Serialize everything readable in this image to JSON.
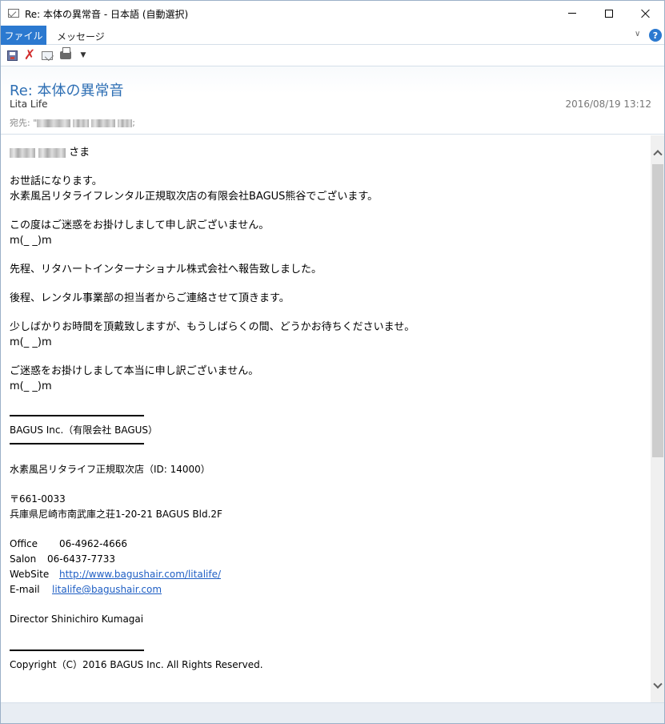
{
  "window": {
    "title": "Re: 本体の異常音 - 日本語 (自動選択)"
  },
  "ribbon": {
    "tabs": [
      "ファイル",
      "メッセージ"
    ],
    "help_glyph": "?"
  },
  "qat": {
    "delete_glyph": "✗",
    "more_glyph": "▼"
  },
  "header": {
    "subject": "Re: 本体の異常音",
    "sender": "Lita Life",
    "date": "2016/08/19 13:12",
    "to_label": "宛先: ",
    "to_prefix": "\"",
    "to_suffix": ";"
  },
  "body": {
    "salutation_suffix": " さま",
    "paragraphs": [
      [
        "お世話になります。",
        "水素風呂リタライフレンタル正規取次店の有限会社BAGUS熊谷でございます。"
      ],
      [
        "この度はご迷惑をお掛けしまして申し訳ございません。",
        "m(_ _)m"
      ],
      [
        "先程、リタハートインターナショナル株式会社へ報告致しました。"
      ],
      [
        "後程、レンタル事業部の担当者からご連絡させて頂きます。"
      ],
      [
        "少しばかりお時間を頂戴致しますが、もうしばらくの間、どうかお待ちくださいませ。",
        "m(_ _)m"
      ],
      [
        "ご迷惑をお掛けしまして本当に申し訳ございません。",
        "m(_ _)m"
      ]
    ]
  },
  "signature": {
    "company": "BAGUS Inc.（有限会社 BAGUS）",
    "store": "水素風呂リタライフ正規取次店（ID: 14000）",
    "postal": "〒661-0033",
    "address": "兵庫県尼崎市南武庫之荘1-20-21 BAGUS Bld.2F",
    "office_label": "Office",
    "office_value": "06-4962-4666",
    "salon_label": "Salon",
    "salon_value": "06-6437-7733",
    "website_label": "WebSite",
    "website_value": "http://www.bagushair.com/litalife/",
    "email_label": "E-mail",
    "email_value": "litalife@bagushair.com",
    "director": "Director Shinichiro Kumagai",
    "copyright": "Copyright（C）2016 BAGUS Inc. All Rights Reserved."
  }
}
